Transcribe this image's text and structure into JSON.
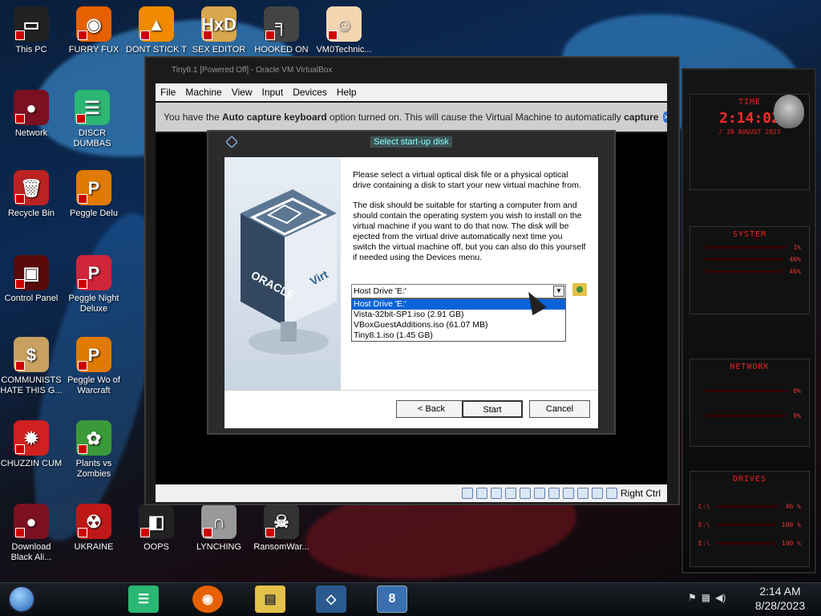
{
  "desktop": {
    "icons": [
      {
        "label": "This PC",
        "icon": "computer-icon",
        "color": "#222"
      },
      {
        "label": "FURRY FUX",
        "icon": "firefox-icon",
        "color": "#e66000"
      },
      {
        "label": "DONT STICK T",
        "icon": "vlc-icon",
        "color": "#f08a00"
      },
      {
        "label": "SEX EDITOR",
        "icon": "hxd-icon",
        "color": "#d9a84e"
      },
      {
        "label": "HOOKED ON",
        "icon": "hooked-icon",
        "color": "#444"
      },
      {
        "label": "VM0Technic...",
        "icon": "doctor-icon",
        "color": "#f3d6b0"
      },
      {
        "label": "Network",
        "icon": "network-icon",
        "color": "#7a1020"
      },
      {
        "label": "DISCR DUMBAS",
        "icon": "chat-icon",
        "color": "#2bb673"
      },
      {
        "label": "Recycle Bin",
        "icon": "trash-icon",
        "color": "#b22"
      },
      {
        "label": "Peggle Delu",
        "icon": "peggle-icon",
        "color": "#e07a00"
      },
      {
        "label": "Control Panel",
        "icon": "control-panel-icon",
        "color": "#5a0a0a"
      },
      {
        "label": "Peggle Night Deluxe",
        "icon": "peggle-night-icon",
        "color": "#d0243a"
      },
      {
        "label": "COMMUNISTS HATE THIS G...",
        "icon": "money-bag-icon",
        "color": "#c8a060"
      },
      {
        "label": "Peggle Wo of Warcraft",
        "icon": "peggle-wow-icon",
        "color": "#e07a00"
      },
      {
        "label": "CHUZZIN CUM",
        "icon": "chuzzle-icon",
        "color": "#d02020"
      },
      {
        "label": "Plants vs Zombies",
        "icon": "flower-icon",
        "color": "#3a9a3a"
      },
      {
        "label": "Download Black Ali...",
        "icon": "alien-icon",
        "color": "#7a1020"
      },
      {
        "label": "UKRAINE",
        "icon": "radiation-icon",
        "color": "#c01818"
      },
      {
        "label": "OOPS",
        "icon": "oops-icon",
        "color": "#222"
      },
      {
        "label": "LYNCHING",
        "icon": "rope-icon",
        "color": "#999"
      },
      {
        "label": "RansomWar...",
        "icon": "skull-icon",
        "color": "#333"
      }
    ]
  },
  "gadget": {
    "time_title": "TIME",
    "time_value": "2:14:02",
    "date_value": "/ 28 AUGUST 2023",
    "system_title": "SYSTEM",
    "system_rows": [
      "1%",
      "46%",
      "46%"
    ],
    "network_title": "NETWORK",
    "network_rows": [
      "0%",
      "0%"
    ],
    "drives_title": "DRIVES",
    "drive_rows": [
      {
        "label": "C:\\",
        "value": "46 %"
      },
      {
        "label": "E:\\",
        "value": "100 %"
      },
      {
        "label": "E:\\",
        "value": "100 %"
      }
    ]
  },
  "vbox": {
    "title": "Tiny8.1 [Powered Off] - Oracle VM VirtualBox",
    "menu": [
      "File",
      "Machine",
      "View",
      "Input",
      "Devices",
      "Help"
    ],
    "notify_pre": "You have the ",
    "notify_bold1": "Auto capture keyboard",
    "notify_mid": " option turned on. This will cause the Virtual Machine to automatically ",
    "notify_bold2": "capture",
    "status_right": "Right Ctrl"
  },
  "dialog": {
    "title": "Select start-up disk",
    "para1": "Please select a virtual optical disk file or a physical optical drive containing a disk to start your new virtual machine from.",
    "para2": "The disk should be suitable for starting a computer from and should contain the operating system you wish to install on the virtual machine if you want to do that now. The disk will be ejected from the virtual drive automatically next time you switch the virtual machine off, but you can also do this yourself if needed using the Devices menu.",
    "combo_value": "Host Drive 'E:'",
    "options": [
      "Host Drive 'E:'",
      "Vista-32bit-SP1.iso (2.91 GB)",
      "VBoxGuestAdditions.iso (61.07 MB)",
      "Tiny8.1.iso (1.45 GB)"
    ],
    "selected_index": 0,
    "back_label": "< Back",
    "start_label": "Start",
    "cancel_label": "Cancel",
    "art_text": "ORACLE",
    "art_text2": "Virt"
  },
  "taskbar": {
    "time": "2:14 AM",
    "date": "8/28/2023"
  }
}
